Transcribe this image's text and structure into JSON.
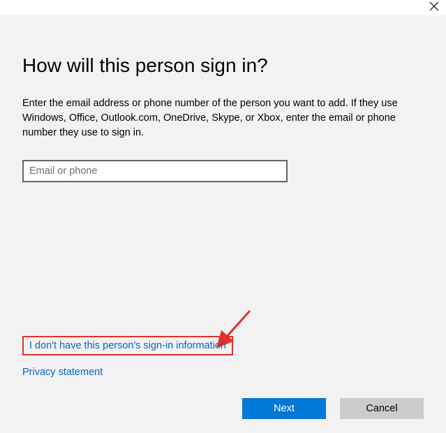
{
  "window": {
    "close_icon": "close"
  },
  "dialog": {
    "heading": "How will this person sign in?",
    "body": "Enter the email address or phone number of the person you want to add. If they use Windows, Office, Outlook.com, OneDrive, Skype, or Xbox, enter the email or phone number they use to sign in.",
    "input": {
      "value": "",
      "placeholder": "Email or phone"
    },
    "links": {
      "no_info": "I don't have this person's sign-in information",
      "privacy": "Privacy statement"
    },
    "buttons": {
      "next": "Next",
      "cancel": "Cancel"
    }
  },
  "annotation": {
    "highlight_color": "#e2302c"
  }
}
